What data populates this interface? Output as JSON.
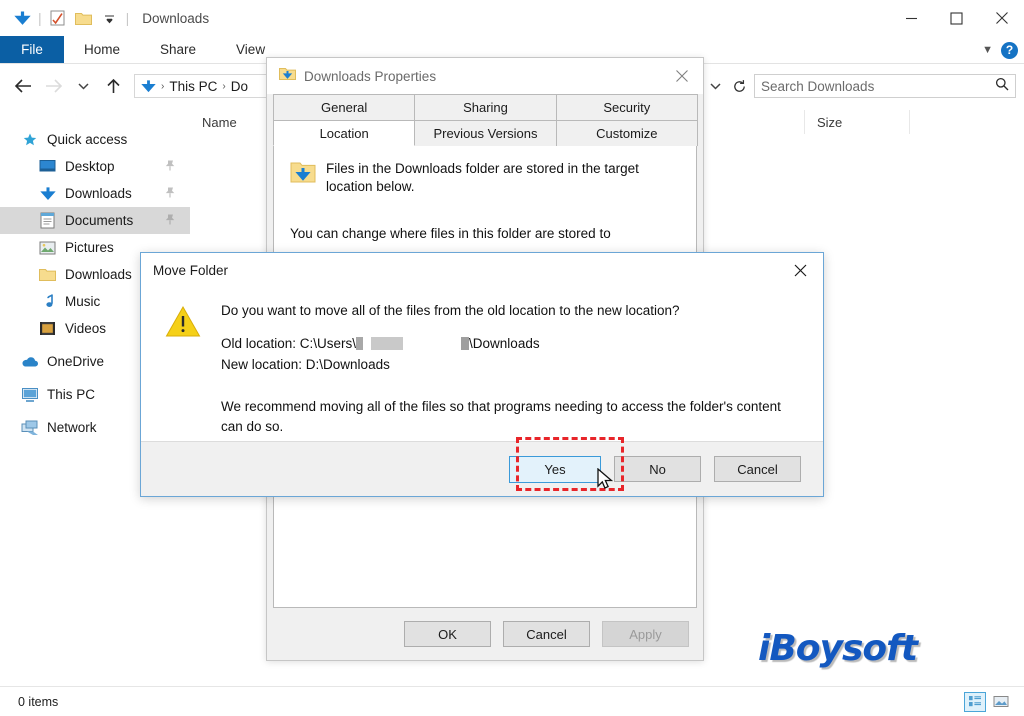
{
  "explorer": {
    "window_title": "Downloads",
    "quick_access_toolbar": [
      {
        "name": "downloads-arrow-icon",
        "label": "Downloads"
      },
      {
        "name": "properties-icon",
        "label": "Properties"
      },
      {
        "name": "new-folder-icon",
        "label": "New folder"
      },
      {
        "name": "customize-chevron-icon",
        "label": "Customize Quick Access Toolbar"
      }
    ],
    "window_controls": {
      "minimize": "Minimize",
      "maximize": "Maximize",
      "close": "Close"
    },
    "ribbon_tabs": [
      {
        "label": "File",
        "active": true
      },
      {
        "label": "Home",
        "active": false
      },
      {
        "label": "Share",
        "active": false
      },
      {
        "label": "View",
        "active": false
      }
    ],
    "ribbon_right": {
      "expand_label": "Expand the Ribbon",
      "help_label": "?"
    },
    "nav": {
      "back_label": "Back",
      "forward_label": "Forward",
      "recent_label": "Recent locations",
      "up_label": "Up"
    },
    "breadcrumb": {
      "icon": "downloads-arrow-icon",
      "segments": [
        "This PC",
        "Do"
      ],
      "separator": "›"
    },
    "address_right": {
      "dropdown_label": "Previous locations",
      "refresh_label": "Refresh"
    },
    "search": {
      "placeholder": "Search Downloads",
      "value": "",
      "icon": "search-icon"
    },
    "columns": [
      {
        "label": "Name"
      },
      {
        "label": ""
      },
      {
        "label": "Size"
      },
      {
        "label": ""
      }
    ],
    "sidebar": [
      {
        "label": "Quick access",
        "icon": "star-pin-icon",
        "indent": false,
        "selected": false,
        "pinned": false
      },
      {
        "label": "Desktop",
        "icon": "desktop-icon",
        "indent": true,
        "selected": false,
        "pinned": true
      },
      {
        "label": "Downloads",
        "icon": "downloads-arrow-icon",
        "indent": true,
        "selected": false,
        "pinned": true
      },
      {
        "label": "Documents",
        "icon": "documents-icon",
        "indent": true,
        "selected": true,
        "pinned": true
      },
      {
        "label": "Pictures",
        "icon": "pictures-icon",
        "indent": true,
        "selected": false,
        "pinned": false
      },
      {
        "label": "Downloads",
        "icon": "folder-icon",
        "indent": true,
        "selected": false,
        "pinned": false
      },
      {
        "label": "Music",
        "icon": "music-note-icon",
        "indent": true,
        "selected": false,
        "pinned": false
      },
      {
        "label": "Videos",
        "icon": "videos-icon",
        "indent": true,
        "selected": false,
        "pinned": false
      },
      {
        "label": "OneDrive",
        "icon": "cloud-icon",
        "indent": false,
        "selected": false,
        "pinned": false
      },
      {
        "label": "This PC",
        "icon": "this-pc-icon",
        "indent": false,
        "selected": false,
        "pinned": false
      },
      {
        "label": "Network",
        "icon": "network-icon",
        "indent": false,
        "selected": false,
        "pinned": false
      }
    ],
    "status": {
      "items_text": "0 items",
      "view_details_label": "Details view",
      "view_large_icons_label": "Large icons view"
    },
    "watermark": "iBoysoft"
  },
  "properties_dialog": {
    "title": "Downloads Properties",
    "icon": "downloads-folder-icon",
    "close_label": "Close",
    "tabs_row1": [
      {
        "label": "General",
        "active": false
      },
      {
        "label": "Sharing",
        "active": false
      },
      {
        "label": "Security",
        "active": false
      }
    ],
    "tabs_row2": [
      {
        "label": "Location",
        "active": true
      },
      {
        "label": "Previous Versions",
        "active": false
      },
      {
        "label": "Customize",
        "active": false
      }
    ],
    "body_text_1": "Files in the Downloads folder are stored in the target location below.",
    "body_text_2": "You can change where files in this folder are stored to",
    "buttons": [
      {
        "label": "OK",
        "enabled": true
      },
      {
        "label": "Cancel",
        "enabled": true
      },
      {
        "label": "Apply",
        "enabled": false
      }
    ]
  },
  "move_folder_dialog": {
    "title": "Move Folder",
    "close_label": "Close",
    "warning_icon": "warning-triangle-icon",
    "question": "Do you want to move all of the files from the old location to the new location?",
    "old_location_label": "Old location: C:\\Users\\",
    "old_location_suffix": "\\Downloads",
    "new_location": "New location: D:\\Downloads",
    "recommendation": "We recommend moving all of the files so that programs needing to access the folder's content can do so.",
    "buttons": [
      {
        "label": "Yes",
        "highlighted": true
      },
      {
        "label": "No",
        "highlighted": false
      },
      {
        "label": "Cancel",
        "highlighted": false
      }
    ],
    "annotation_color": "#e8252a"
  }
}
